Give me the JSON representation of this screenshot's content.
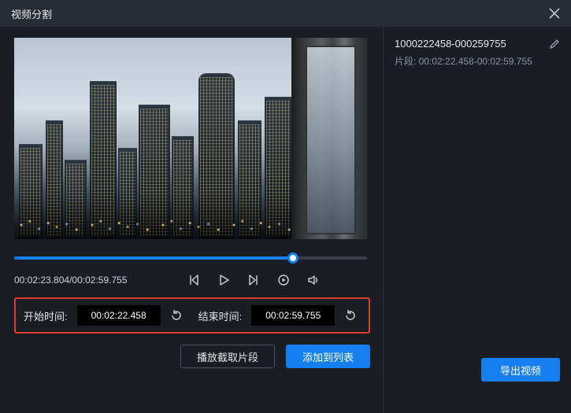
{
  "titlebar": {
    "title": "视频分割"
  },
  "playback": {
    "current": "00:02:23.804",
    "duration": "00:02:59.755",
    "slider_percent": 79
  },
  "time_inputs": {
    "start_label": "开始时间:",
    "start_value": "00:02:22.458",
    "end_label": "结束时间:",
    "end_value": "00:02:59.755"
  },
  "buttons": {
    "play_segment": "播放截取片段",
    "add_to_list": "添加到列表",
    "export": "导出视频"
  },
  "segment": {
    "name": "1000222458-000259755",
    "range_label": "片段: 00:02:22.458-00:02:59.755"
  }
}
